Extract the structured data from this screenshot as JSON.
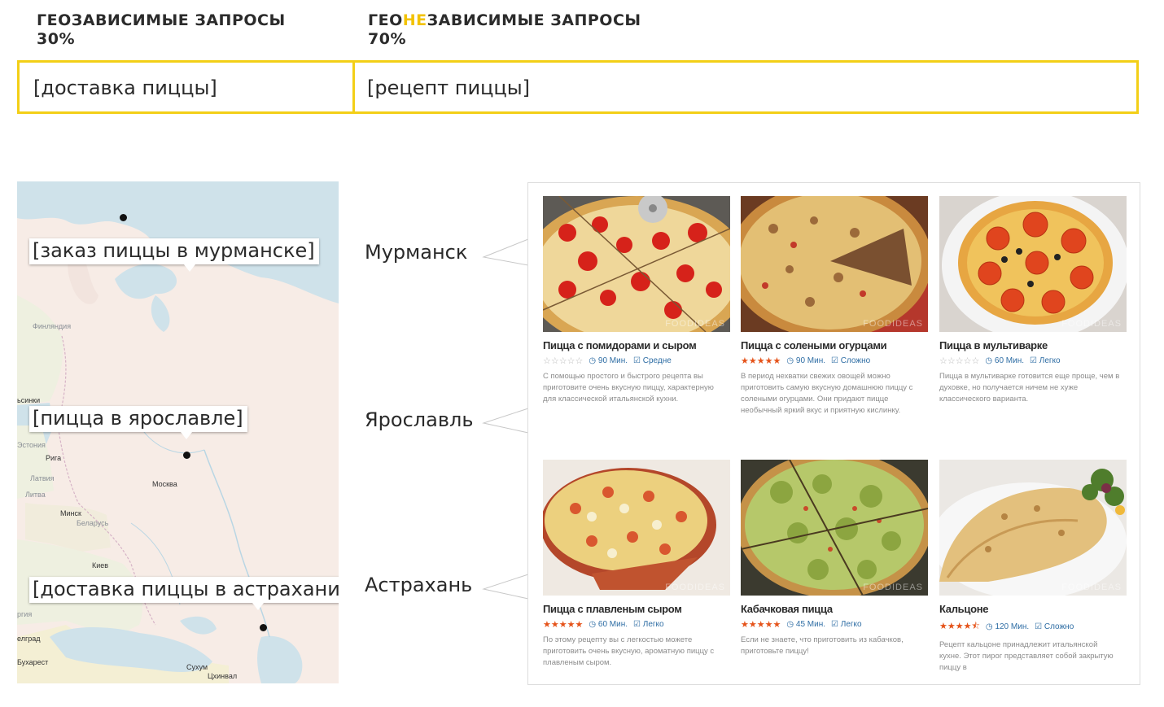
{
  "header": {
    "geo_title": "ГЕОЗАВИСИМЫЕ ЗАПРОСЫ",
    "geo_pct": "30%",
    "nongeo_prefix": "ГЕО",
    "nongeo_hl": "НЕ",
    "nongeo_suffix": "ЗАВИСИМЫЕ ЗАПРОСЫ",
    "nongeo_pct": "70%",
    "accent": "#f3cf17"
  },
  "queries": {
    "geo": "[доставка пиццы]",
    "nongeo": "[рецепт пиццы]"
  },
  "map": {
    "callouts": {
      "murmansk": "[заказ пиццы в мурманске]",
      "yaroslavl": "[пицца в ярославле]",
      "astrakhan": "[доставка пиццы в астрахани]"
    },
    "labels": {
      "finland": "Финляндия",
      "helsinki": "ьсинки",
      "estonia": "Эстония",
      "riga": "Рига",
      "latvia": "Латвия",
      "lithuania": "Литва",
      "moscow": "Москва",
      "minsk": "Минск",
      "belarus": "Беларусь",
      "kiev": "Киев",
      "belgrade": "елград",
      "bucharest": "Бухарест",
      "sukhum": "Сухум",
      "tskhinvali": "Цхинвал",
      "sea_frag": "ргия",
      "bucharest_sub": "Бухарест"
    }
  },
  "cities": [
    "Мурманск",
    "Ярославль",
    "Астрахань"
  ],
  "recipes": [
    {
      "title": "Пицца с помидорами и сыром",
      "rating": 0,
      "time": "90 Мин.",
      "level": "Средне",
      "desc": "С помощью простого и быстрого рецепта вы приготовите очень вкусную пиццу, характерную для классической итальянской кухни."
    },
    {
      "title": "Пицца с солеными огурцами",
      "rating": 5,
      "time": "90 Мин.",
      "level": "Сложно",
      "desc": "В период нехватки свежих овощей можно приготовить самую вкусную домашнюю пиццу с солеными огурцами. Они придают пицце необычный яркий вкус и приятную кислинку."
    },
    {
      "title": "Пицца в мультиварке",
      "rating": 0,
      "time": "60 Мин.",
      "level": "Легко",
      "desc": "Пицца в мультиварке готовится еще проще, чем в духовке, но получается ничем не хуже классического варианта."
    },
    {
      "title": "Пицца с плавленым сыром",
      "rating": 5,
      "time": "60 Мин.",
      "level": "Легко",
      "desc": "По этому рецепту вы с легкостью можете приготовить очень вкусную, ароматную пиццу с плавленым сыром."
    },
    {
      "title": "Кабачковая пицца",
      "rating": 5,
      "time": "45 Мин.",
      "level": "Легко",
      "desc": "Если не знаете, что приготовить из кабачков, приготовьте пиццу!"
    },
    {
      "title": "Кальцоне",
      "rating": 4.5,
      "time": "120 Мин.",
      "level": "Сложно",
      "desc": "Рецепт кальцоне принадлежит итальянской кухне. Этот пирог представляет собой закрытую пиццу в"
    }
  ],
  "watermark": "FOODIDEAS"
}
